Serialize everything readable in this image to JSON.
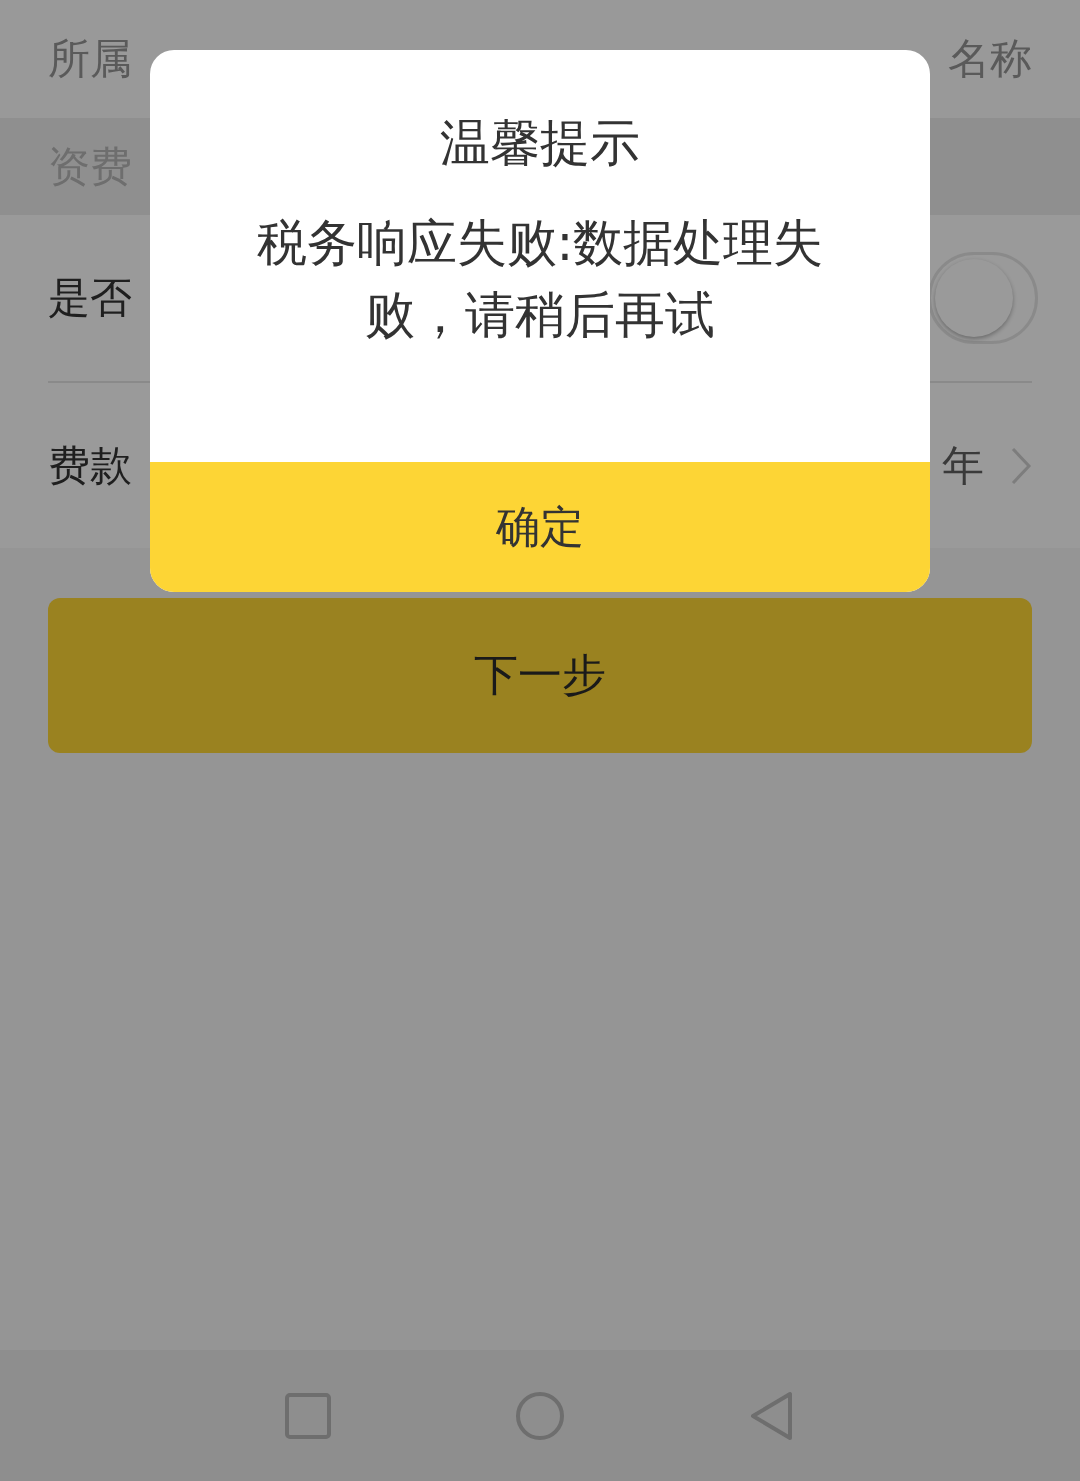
{
  "form": {
    "rows": [
      {
        "kind": "field",
        "label": "所属",
        "value": "名称"
      },
      {
        "kind": "section",
        "label": "资费"
      },
      {
        "kind": "switch",
        "label": "是否",
        "on": false
      },
      {
        "kind": "select",
        "label": "费款",
        "value": "年"
      }
    ]
  },
  "next_button": "下一步",
  "dialog": {
    "title": "温馨提示",
    "message": "税务响应失败:数据处理失败，请稍后再试",
    "button": "确定"
  }
}
